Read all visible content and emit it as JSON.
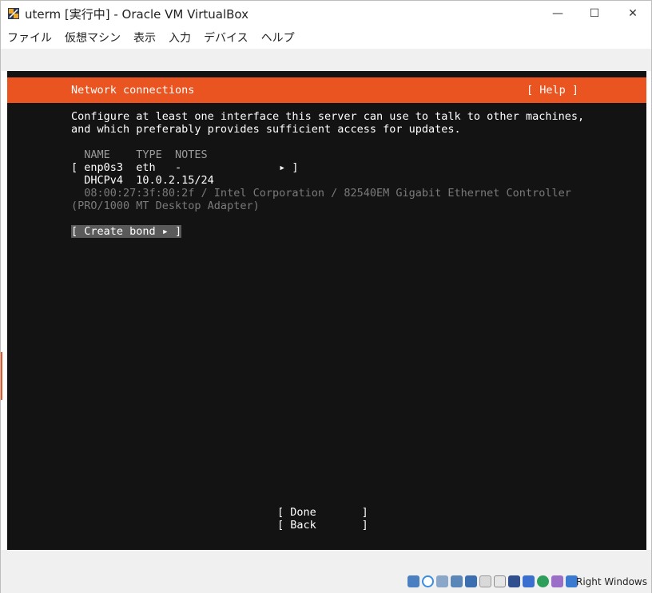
{
  "window": {
    "title": "uterm [実行中] - Oracle VM VirtualBox",
    "minimize": "—",
    "maximize": "☐",
    "close": "✕"
  },
  "menu": {
    "items": [
      "ファイル",
      "仮想マシン",
      "表示",
      "入力",
      "デバイス",
      "ヘルプ"
    ]
  },
  "installer": {
    "header_title": "Network connections",
    "help_label": "[ Help ]",
    "description_line1": "Configure at least one interface this server can use to talk to other machines,",
    "description_line2": "and which preferably provides sufficient access for updates.",
    "columns_header": "  NAME    TYPE  NOTES",
    "interface_row": "[ enp0s3  eth   -               ▸ ]",
    "dhcp_row": "  DHCPv4  10.0.2.15/24",
    "detail_line1": "  08:00:27:3f:80:2f / Intel Corporation / 82540EM Gigabit Ethernet Controller",
    "detail_line2": "(PRO/1000 MT Desktop Adapter)",
    "create_bond": "[ Create bond ▸ ]",
    "done_button": "[ Done       ]",
    "back_button": "[ Back       ]"
  },
  "statusbar": {
    "host_key": "Right Windows",
    "icons": [
      "hard-disk-icon",
      "optical-drive-icon",
      "audio-icon",
      "network-icon",
      "usb-icon",
      "shared-folders-icon",
      "display-icon",
      "video-capture-icon",
      "mouse-integration-icon",
      "cpu-icon",
      "recording-icon",
      "keyboard-capture-icon"
    ]
  },
  "colors": {
    "accent": "#e95420",
    "screen_bg": "#131313"
  }
}
